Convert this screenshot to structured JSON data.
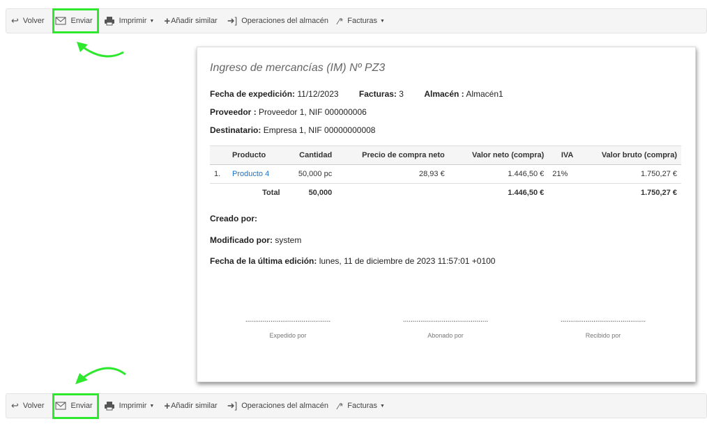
{
  "toolbar": {
    "back": "Volver",
    "send": "Enviar",
    "print": "Imprimir",
    "add_similar": "Añadir similar",
    "warehouse_ops": "Operaciones del almacén",
    "invoices": "Facturas"
  },
  "doc": {
    "title": "Ingreso de mercancías (IM) Nº PZ3",
    "issue_date_label": "Fecha de expedición:",
    "issue_date": "11/12/2023",
    "invoices_label": "Facturas:",
    "invoices": "3",
    "warehouse_label": "Almacén :",
    "warehouse": "Almacén1",
    "supplier_label": "Proveedor :",
    "supplier": "Proveedor 1, NIF 000000006",
    "recipient_label": "Destinatario:",
    "recipient": "Empresa 1, NIF 00000000008",
    "table": {
      "headers": [
        "Producto",
        "Cantidad",
        "Precio de compra neto",
        "Valor neto (compra)",
        "IVA",
        "Valor bruto (compra)"
      ],
      "rows": [
        {
          "num": "1.",
          "product": "Producto 4",
          "qty": "50,000 pc",
          "price": "28,93 €",
          "net": "1.446,50 €",
          "vat": "21%",
          "gross": "1.750,27 €"
        }
      ],
      "total": {
        "label": "Total",
        "qty": "50,000",
        "net": "1.446,50 €",
        "gross": "1.750,27 €"
      }
    },
    "created_by_label": "Creado por:",
    "created_by": "",
    "modified_by_label": "Modificado por:",
    "modified_by": "system",
    "last_edit_label": "Fecha de la última edición:",
    "last_edit": "lunes, 11 de diciembre de 2023 11:57:01 +0100",
    "signatures": [
      "Expedido por",
      "Abonado por",
      "Recibido por"
    ],
    "dots": "............................................"
  },
  "colors": {
    "highlight": "#2ee82e",
    "link": "#1a73c8"
  }
}
